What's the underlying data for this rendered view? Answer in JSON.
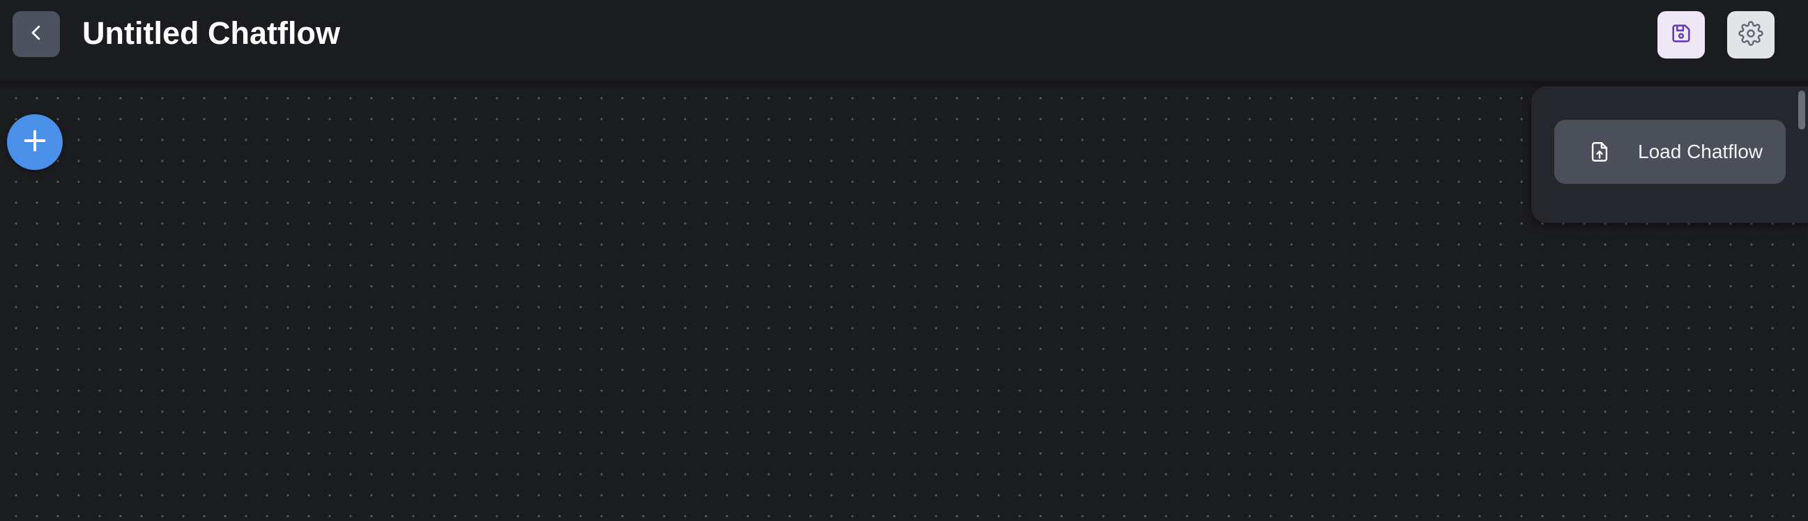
{
  "header": {
    "back_icon": "chevron-left-icon",
    "title": "Untitled Chatflow",
    "save_icon": "floppy-disk-icon",
    "settings_icon": "gear-icon"
  },
  "canvas": {
    "add_icon": "plus-icon"
  },
  "settings_menu": {
    "items": [
      {
        "label": "Load Chatflow",
        "icon": "file-upload-icon"
      }
    ]
  },
  "colors": {
    "background": "#1b1c20",
    "add_button": "#4a90e8",
    "save_button_bg": "#ede7f6",
    "save_icon": "#673ab7",
    "menu_bg": "#26272c",
    "menu_item_bg": "#4a4f5a"
  }
}
